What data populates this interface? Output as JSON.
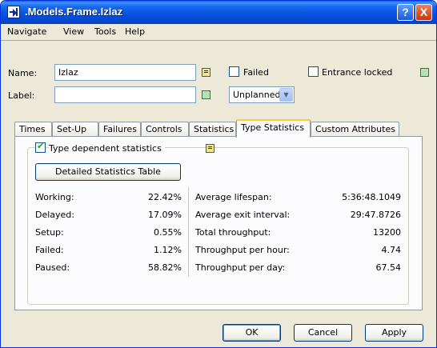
{
  "window": {
    "title": ".Models.Frame.Izlaz"
  },
  "titlebar_buttons": {
    "help": "?",
    "close": "X"
  },
  "menu": [
    "Navigate",
    "View",
    "Tools",
    "Help"
  ],
  "form": {
    "name_label": "Name:",
    "name_value": "Izlaz",
    "label_label": "Label:",
    "label_value": "",
    "failed_label": "Failed",
    "entrance_locked_label": "Entrance locked",
    "state_select": "Unplanned"
  },
  "tabs": [
    "Times",
    "Set-Up",
    "Failures",
    "Controls",
    "Statistics",
    "Type Statistics",
    "Custom Attributes"
  ],
  "active_tab": "Type Statistics",
  "type_stats": {
    "checkbox_label": "Type dependent statistics",
    "checkbox_checked": true,
    "detail_button": "Detailed Statistics Table",
    "left": [
      {
        "label": "Working:",
        "value": "22.42%"
      },
      {
        "label": "Delayed:",
        "value": "17.09%"
      },
      {
        "label": "Setup:",
        "value": "0.55%"
      },
      {
        "label": "Failed:",
        "value": "1.12%"
      },
      {
        "label": "Paused:",
        "value": "58.82%"
      }
    ],
    "right": [
      {
        "label": "Average lifespan:",
        "value": "5:36:48.1049"
      },
      {
        "label": "Average exit interval:",
        "value": "29:47.8726"
      },
      {
        "label": "Total throughput:",
        "value": "13200"
      },
      {
        "label": "Throughput per hour:",
        "value": "4.74"
      },
      {
        "label": "Throughput per day:",
        "value": "67.54"
      }
    ]
  },
  "buttons": {
    "ok": "OK",
    "cancel": "Cancel",
    "apply": "Apply"
  }
}
